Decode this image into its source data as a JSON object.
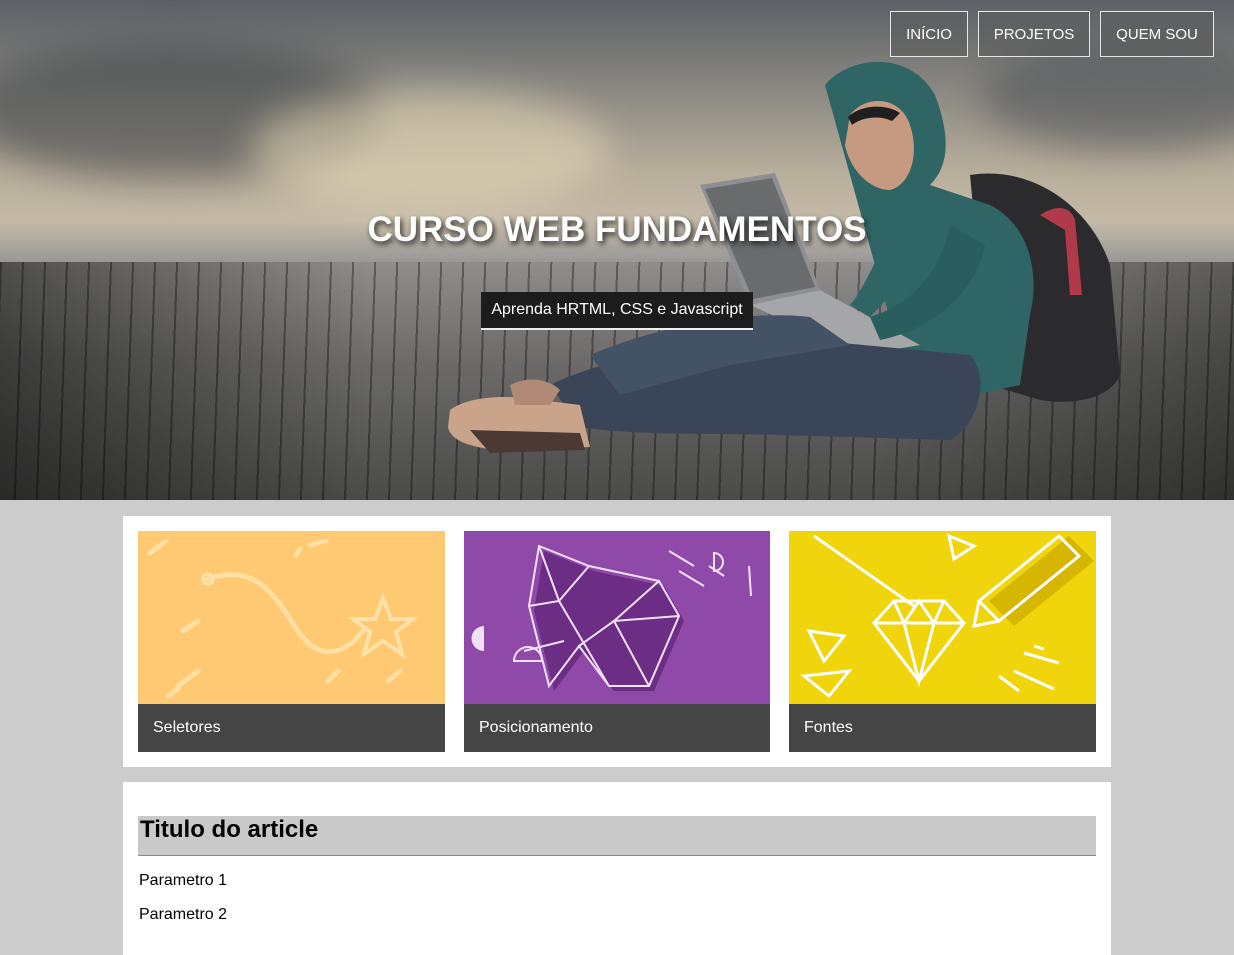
{
  "nav": {
    "items": [
      {
        "label": "INÍCIO"
      },
      {
        "label": "PROJETOS"
      },
      {
        "label": "QUEM SOU"
      }
    ]
  },
  "hero": {
    "title": "CURSO WEB FUNDAMENTOS",
    "subtitle": "Aprenda HRTML, CSS e Javascript"
  },
  "cards": [
    {
      "label": "Seletores",
      "color": "#ffc973"
    },
    {
      "label": "Posicionamento",
      "color": "#8f49a8"
    },
    {
      "label": "Fontes",
      "color": "#f0d40c"
    }
  ],
  "article": {
    "title": "Titulo do article",
    "params": [
      "Parametro 1",
      "Parametro 2"
    ]
  }
}
